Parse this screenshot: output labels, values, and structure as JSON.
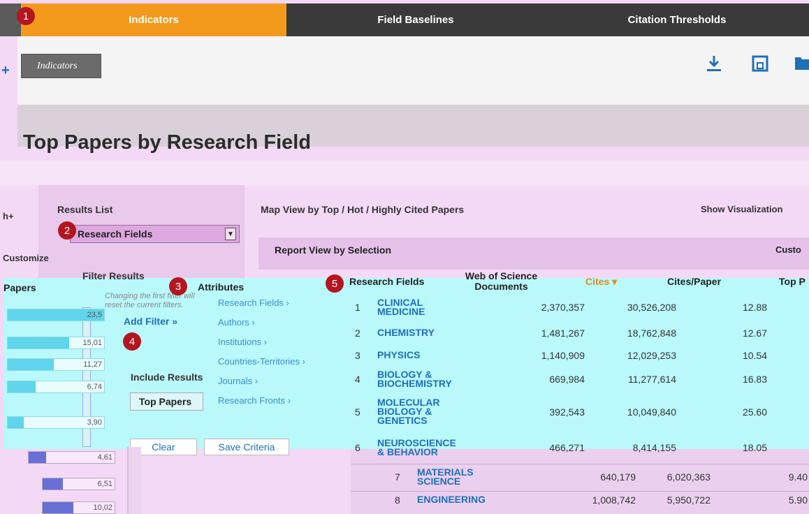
{
  "tabs": [
    {
      "label": "Indicators"
    },
    {
      "label": "Field Baselines"
    },
    {
      "label": "Citation Thresholds"
    }
  ],
  "markers": [
    "1",
    "2",
    "3",
    "4",
    "5"
  ],
  "header": {
    "chip_label": "Indicators",
    "download_icon": "download-icon",
    "print_icon": "print-icon",
    "folder_icon": "folder-icon"
  },
  "page_title": "Top Papers by Research Field",
  "results_list": {
    "label": "Results List",
    "select_value": "Research Fields",
    "customize_label": "Customize"
  },
  "map_view_label": "Map View by Top / Hot / Highly Cited Papers",
  "show_visualization_label": "Show Visualization",
  "report_view_label": "Report View by Selection",
  "customize_right_label": "Custo",
  "filter": {
    "title": "Filter Results",
    "hint": "Changing the first filter will reset the current filters.",
    "add_filter": "Add Filter »",
    "include_label": "Include Results",
    "top_papers": "Top Papers",
    "clear": "Clear",
    "save": "Save Criteria"
  },
  "attributes": {
    "title": "Attributes",
    "items": [
      "Research Fields ›",
      "Authors ›",
      "Institutions ›",
      "Countries-Territories ›",
      "Journals ›",
      "Research Fronts ›"
    ]
  },
  "left_table": {
    "header": "Papers",
    "bars": [
      {
        "value": "23,5",
        "fraction": 1.0
      },
      {
        "value": "15,01",
        "fraction": 0.64
      },
      {
        "value": "11,27",
        "fraction": 0.48
      },
      {
        "value": "6,74",
        "fraction": 0.29
      },
      {
        "value": "3,90",
        "fraction": 0.17
      },
      {
        "value": "4,61",
        "fraction": 0.2
      },
      {
        "value": "6,51",
        "fraction": 0.28
      },
      {
        "value": "10,02",
        "fraction": 0.43
      }
    ]
  },
  "table": {
    "columns": {
      "field": "Research Fields",
      "docs": "Web of Science Documents",
      "cites": "Cites ▾",
      "cites_paper": "Cites/Paper",
      "top": "Top P"
    },
    "rows": [
      {
        "rank": "1",
        "field_lines": [
          "CLINICAL",
          "MEDICINE"
        ],
        "docs": "2,370,357",
        "cites": "30,526,208",
        "cpp": "12.88"
      },
      {
        "rank": "2",
        "field_lines": [
          "CHEMISTRY"
        ],
        "docs": "1,481,267",
        "cites": "18,762,848",
        "cpp": "12.67"
      },
      {
        "rank": "3",
        "field_lines": [
          "PHYSICS"
        ],
        "docs": "1,140,909",
        "cites": "12,029,253",
        "cpp": "10.54"
      },
      {
        "rank": "4",
        "field_lines": [
          "BIOLOGY &",
          "BIOCHEMISTRY"
        ],
        "docs": "669,984",
        "cites": "11,277,614",
        "cpp": "16.83"
      },
      {
        "rank": "5",
        "field_lines": [
          "MOLECULAR",
          "BIOLOGY &",
          "GENETICS"
        ],
        "docs": "392,543",
        "cites": "10,049,840",
        "cpp": "25.60"
      },
      {
        "rank": "6",
        "field_lines": [
          "NEUROSCIENCE",
          "& BEHAVIOR"
        ],
        "docs": "466,271",
        "cites": "8,414,155",
        "cpp": "18.05"
      },
      {
        "rank": "7",
        "field_lines": [
          "MATERIALS",
          "SCIENCE"
        ],
        "docs": "640,179",
        "cites": "6,020,363",
        "cpp": "9.40"
      },
      {
        "rank": "8",
        "field_lines": [
          "ENGINEERING"
        ],
        "docs": "1,008,742",
        "cites": "5,950,722",
        "cpp": "5.90"
      }
    ]
  }
}
